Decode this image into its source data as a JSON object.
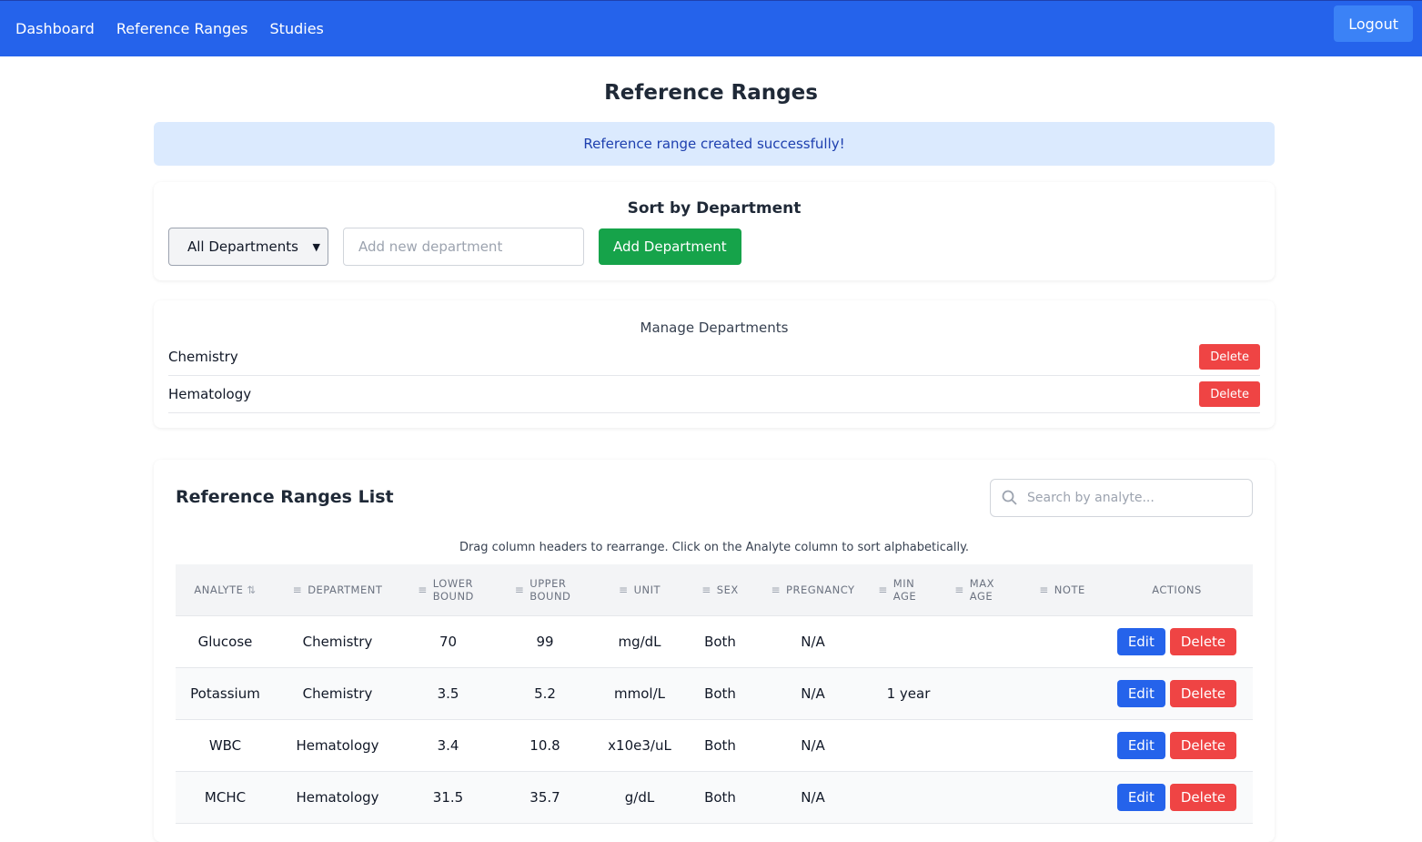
{
  "nav": {
    "items": [
      "Dashboard",
      "Reference Ranges",
      "Studies"
    ],
    "logout": "Logout"
  },
  "page": {
    "title": "Reference Ranges",
    "alert": "Reference range created successfully!"
  },
  "sort": {
    "title": "Sort by Department",
    "selected": "All Departments",
    "placeholder": "Add new department",
    "add": "Add Department"
  },
  "manage": {
    "title": "Manage Departments",
    "departments": [
      "Chemistry",
      "Hematology"
    ],
    "delete": "Delete"
  },
  "list": {
    "title": "Reference Ranges List",
    "search_placeholder": "Search by analyte...",
    "hint": "Drag column headers to rearrange. Click on the Analyte column to sort alphabetically.",
    "headers": [
      "ANALYTE",
      "DEPARTMENT",
      "LOWER BOUND",
      "UPPER BOUND",
      "UNIT",
      "SEX",
      "PREGNANCY",
      "MIN AGE",
      "MAX AGE",
      "NOTE",
      "ACTIONS"
    ],
    "edit": "Edit",
    "delete": "Delete",
    "rows": [
      [
        "Glucose",
        "Chemistry",
        "70",
        "99",
        "mg/dL",
        "Both",
        "N/A",
        "",
        "",
        ""
      ],
      [
        "Potassium",
        "Chemistry",
        "3.5",
        "5.2",
        "mmol/L",
        "Both",
        "N/A",
        "1 year",
        "",
        ""
      ],
      [
        "WBC",
        "Hematology",
        "3.4",
        "10.8",
        "x10e3/uL",
        "Both",
        "N/A",
        "",
        "",
        ""
      ],
      [
        "MCHC",
        "Hematology",
        "31.5",
        "35.7",
        "g/dL",
        "Both",
        "N/A",
        "",
        "",
        ""
      ]
    ]
  },
  "colors": {
    "primary": "#2563eb",
    "success": "#16a34a",
    "danger": "#ef4444",
    "alert_bg": "#dbeafe"
  }
}
